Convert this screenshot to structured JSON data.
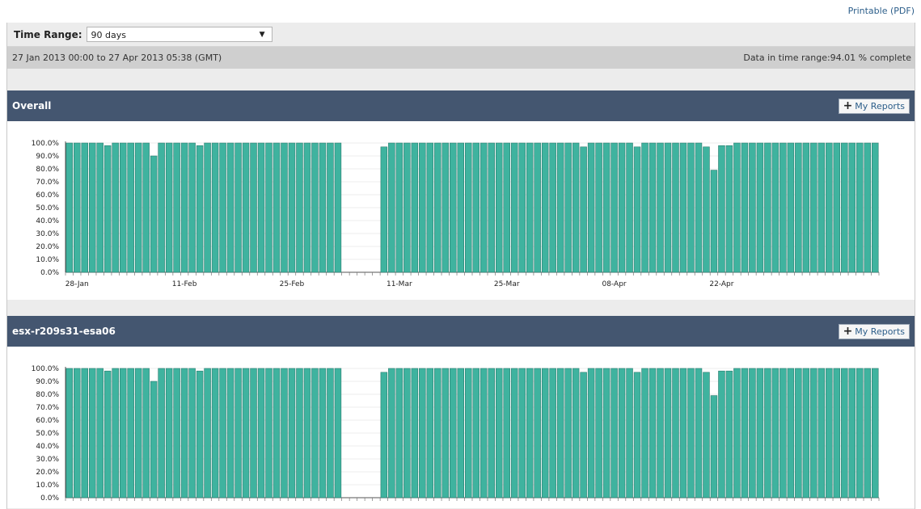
{
  "header": {
    "printable_label": "Printable (PDF)"
  },
  "time_range": {
    "label": "Time Range:",
    "value": "90 days"
  },
  "range_bar": {
    "period": "27 Jan 2013 00:00 to 27 Apr 2013 05:38 (GMT)",
    "completeness": "Data in time range:94.01 % complete"
  },
  "sections": [
    {
      "title": "Overall",
      "my_reports_label": "My Reports"
    },
    {
      "title": "esx-r209s31-esa06",
      "my_reports_label": "My Reports"
    }
  ],
  "colors": {
    "bar": "#3fb39f",
    "bar_stroke": "#2a7c6e",
    "header_bg": "#445670"
  },
  "chart_data": [
    {
      "type": "bar",
      "y_tick_labels": [
        "100.0%",
        "90.0%",
        "80.0%",
        "70.0%",
        "60.0%",
        "50.0%",
        "40.0%",
        "30.0%",
        "20.0%",
        "10.0%",
        "0.0%"
      ],
      "x_tick_labels": [
        "28-Jan",
        "11-Feb",
        "25-Feb",
        "11-Mar",
        "25-Mar",
        "08-Apr",
        "22-Apr"
      ],
      "x_label_days": [
        1,
        15,
        29,
        43,
        57,
        71,
        85
      ],
      "ylim": [
        0,
        100
      ],
      "start_day": 0,
      "values": [
        100,
        100,
        100,
        100,
        100,
        98,
        100,
        100,
        100,
        100,
        100,
        90,
        100,
        100,
        100,
        100,
        100,
        98,
        100,
        100,
        100,
        100,
        100,
        100,
        100,
        100,
        100,
        100,
        100,
        100,
        100,
        100,
        100,
        100,
        100,
        100,
        0,
        0,
        0,
        0,
        0,
        97,
        100,
        100,
        100,
        100,
        100,
        100,
        100,
        100,
        100,
        100,
        100,
        100,
        100,
        100,
        100,
        100,
        100,
        100,
        100,
        100,
        100,
        100,
        100,
        100,
        100,
        97,
        100,
        100,
        100,
        100,
        100,
        100,
        97,
        100,
        100,
        100,
        100,
        100,
        100,
        100,
        100,
        97,
        79,
        98,
        98,
        100,
        100,
        100,
        100,
        100,
        100,
        100,
        100,
        100,
        100,
        100,
        100,
        100,
        100,
        100,
        100,
        100,
        100,
        100
      ]
    },
    {
      "type": "bar",
      "y_tick_labels": [
        "100.0%",
        "90.0%",
        "80.0%",
        "70.0%",
        "60.0%",
        "50.0%",
        "40.0%",
        "30.0%",
        "20.0%",
        "10.0%",
        "0.0%"
      ],
      "x_tick_labels": [],
      "x_label_days": [],
      "ylim": [
        0,
        100
      ],
      "start_day": 0,
      "values": [
        100,
        100,
        100,
        100,
        100,
        98,
        100,
        100,
        100,
        100,
        100,
        90,
        100,
        100,
        100,
        100,
        100,
        98,
        100,
        100,
        100,
        100,
        100,
        100,
        100,
        100,
        100,
        100,
        100,
        100,
        100,
        100,
        100,
        100,
        100,
        100,
        0,
        0,
        0,
        0,
        0,
        97,
        100,
        100,
        100,
        100,
        100,
        100,
        100,
        100,
        100,
        100,
        100,
        100,
        100,
        100,
        100,
        100,
        100,
        100,
        100,
        100,
        100,
        100,
        100,
        100,
        100,
        97,
        100,
        100,
        100,
        100,
        100,
        100,
        97,
        100,
        100,
        100,
        100,
        100,
        100,
        100,
        100,
        97,
        79,
        98,
        98,
        100,
        100,
        100,
        100,
        100,
        100,
        100,
        100,
        100,
        100,
        100,
        100,
        100,
        100,
        100,
        100,
        100,
        100,
        100
      ]
    }
  ]
}
